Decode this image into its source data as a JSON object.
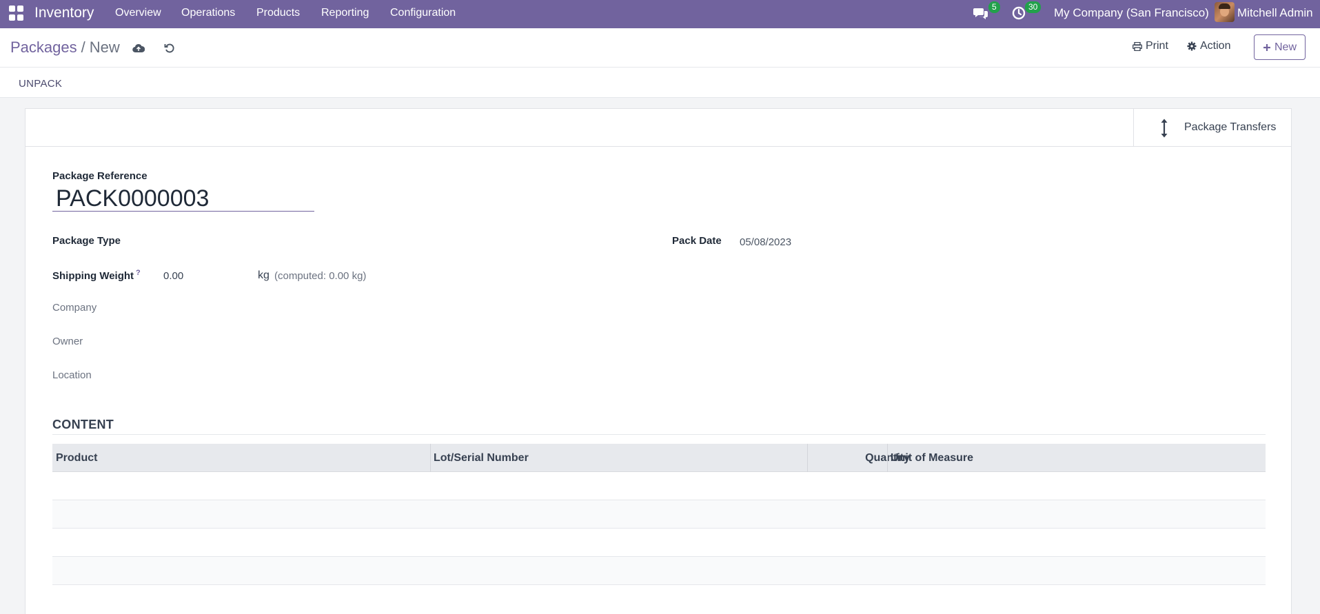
{
  "navbar": {
    "brand": "Inventory",
    "menu": [
      "Overview",
      "Operations",
      "Products",
      "Reporting",
      "Configuration"
    ],
    "messages_count": "5",
    "activities_count": "30",
    "company": "My Company (San Francisco)",
    "user": "Mitchell Admin",
    "color": "#71639e",
    "badge_color": "#22a14b"
  },
  "control_panel": {
    "breadcrumb_parent": "Packages",
    "breadcrumb_separator": "/",
    "breadcrumb_current": "New",
    "print_label": "Print",
    "action_label": "Action",
    "new_label": "New"
  },
  "statusbar": {
    "unpack_label": "UNPACK"
  },
  "smart_buttons": {
    "package_transfers": "Package Transfers"
  },
  "form": {
    "package_reference_label": "Package Reference",
    "package_reference_value": "PACK0000003",
    "package_type_label": "Package Type",
    "package_type_value": "",
    "pack_date_label": "Pack Date",
    "pack_date_value": "05/08/2023",
    "shipping_weight_label": "Shipping Weight",
    "shipping_weight_help": "?",
    "shipping_weight_value": "0.00",
    "weight_unit": "kg",
    "computed_weight": "(computed: 0.00 kg)",
    "company_label": "Company",
    "owner_label": "Owner",
    "location_label": "Location"
  },
  "content": {
    "title": "CONTENT",
    "columns": [
      "Product",
      "Lot/Serial Number",
      "Quantity",
      "Unit of Measure"
    ],
    "rows": []
  }
}
